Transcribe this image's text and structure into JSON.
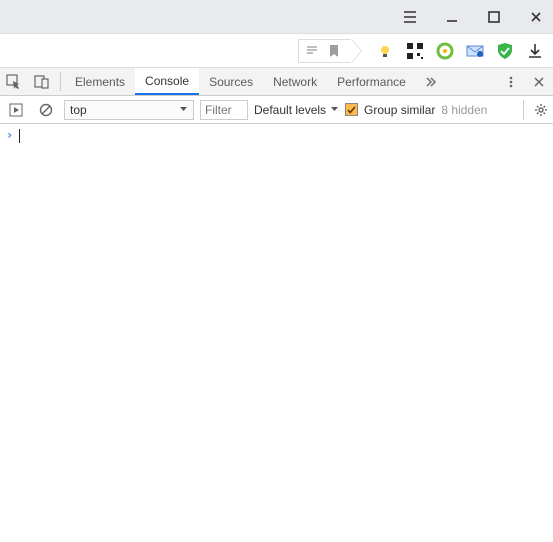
{
  "devtools": {
    "tabs": [
      "Elements",
      "Console",
      "Sources",
      "Network",
      "Performance"
    ],
    "active_tab": "Console"
  },
  "console": {
    "context": "top",
    "filter_placeholder": "Filter",
    "levels_label": "Default levels",
    "group_label": "Group similar",
    "group_checked": true,
    "hidden_label": "8 hidden",
    "prompt": "›"
  }
}
